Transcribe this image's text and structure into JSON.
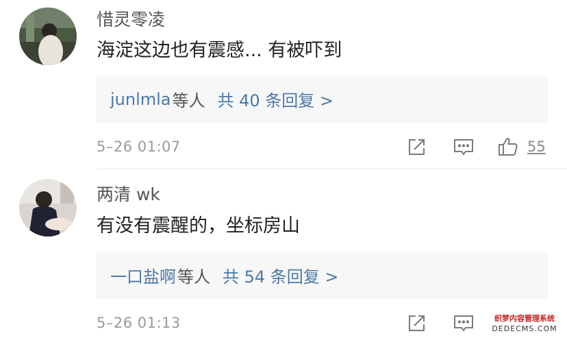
{
  "comments": [
    {
      "username": "惜灵零凌",
      "text": "海淀这边也有震感... 有被吓到",
      "reply_users": "junlmla",
      "reply_etc": "等人",
      "reply_count": "共 40 条回复 >",
      "time": "5–26 01:07",
      "likes": "55",
      "avatar_icon": "user-avatar-photo"
    },
    {
      "username": "两清 wk",
      "text": "有没有震醒的，坐标房山",
      "reply_users": "一口盐啊",
      "reply_etc": "等人",
      "reply_count": "共 54 条回复 >",
      "time": "5–26 01:13",
      "likes": "",
      "avatar_icon": "user-avatar-photo"
    }
  ],
  "icons": {
    "share": "share-icon",
    "reply": "comment-icon",
    "like": "thumbs-up-icon"
  },
  "watermark": {
    "line1": "织梦内容管理系统",
    "line2": "DEDECMS.COM"
  },
  "colors": {
    "link": "#4c78a8",
    "reply_bg": "#f7f7f7",
    "meta": "#9a9a9a",
    "text": "#222222"
  }
}
